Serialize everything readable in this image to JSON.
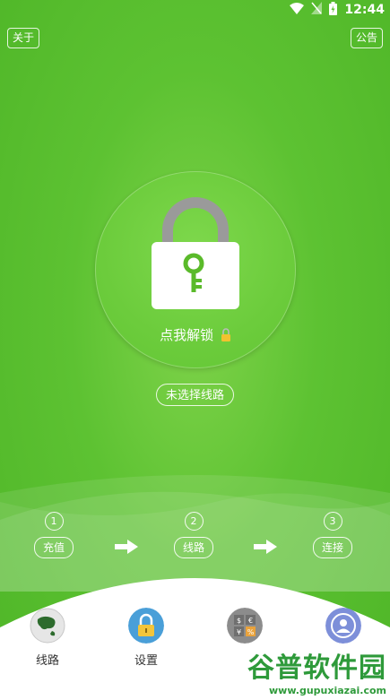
{
  "status_bar": {
    "time": "12:44"
  },
  "header": {
    "about_label": "关于",
    "notice_label": "公告"
  },
  "lock": {
    "unlock_label": "点我解锁"
  },
  "route": {
    "selection_label": "未选择线路"
  },
  "steps": [
    {
      "number": "1",
      "label": "充值"
    },
    {
      "number": "2",
      "label": "线路"
    },
    {
      "number": "3",
      "label": "连接"
    }
  ],
  "bottom_nav": [
    {
      "label": "线路",
      "icon": "globe-icon"
    },
    {
      "label": "设置",
      "icon": "lock-icon"
    },
    {
      "label": "",
      "icon": "currency-icon"
    },
    {
      "label": "",
      "icon": "user-icon"
    }
  ],
  "watermark": {
    "title": "谷普软件园",
    "url": "www.gupuxiazai.com"
  },
  "colors": {
    "primary_green": "#5dc232",
    "lock_gray": "#9a9a9a",
    "key_green": "#5aba2a"
  }
}
